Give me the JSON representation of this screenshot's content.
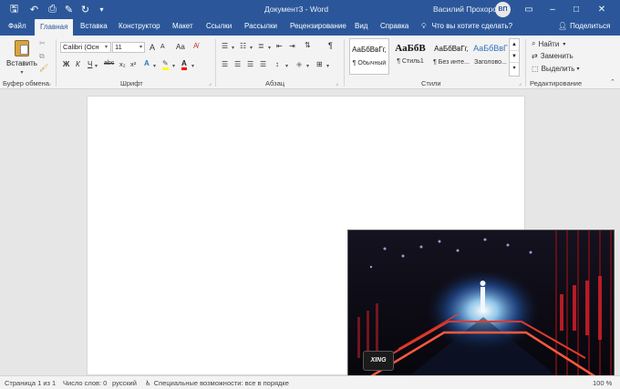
{
  "titlebar": {
    "document_title": "Документ3 - Word",
    "user_name": "Василий Прохоров",
    "user_initials": "ВП"
  },
  "tabs": [
    "Файл",
    "Главная",
    "Вставка",
    "Конструктор",
    "Макет",
    "Ссылки",
    "Рассылки",
    "Рецензирование",
    "Вид",
    "Справка"
  ],
  "tell_me": "Что вы хотите сделать?",
  "share": "Поделиться",
  "clipboard": {
    "paste": "Вставить",
    "label": "Буфер обмена"
  },
  "font": {
    "name": "Calibri (Осн",
    "size": "11",
    "label": "Шрифт",
    "bold": "Ж",
    "italic": "К",
    "underline": "Ч",
    "strike": "abc",
    "sub": "x₂",
    "sup": "x²",
    "grow": "A",
    "shrink": "A",
    "case": "Аа"
  },
  "paragraph": {
    "label": "Абзац"
  },
  "styles": {
    "label": "Стили",
    "items": [
      {
        "sample": "АаБбВвГг,",
        "name": "¶ Обычный"
      },
      {
        "sample": "АаБбВ",
        "name": "¶ Стиль1"
      },
      {
        "sample": "АаБбВвГг,",
        "name": "¶ Без инте..."
      },
      {
        "sample": "АаБбВвГ",
        "name": "Заголово..."
      }
    ]
  },
  "editing": {
    "find": "Найти",
    "replace": "Заменить",
    "select": "Выделить",
    "label": "Редактирование"
  },
  "status": {
    "page": "Страница 1 из 1",
    "words": "Число слов: 0",
    "language": "русский",
    "accessibility": "Специальные возможности: все в порядке",
    "zoom": "100 %"
  },
  "video": {
    "logo_text": "XING"
  },
  "colors": {
    "accent": "#2b579a",
    "highlight": "#ffff00",
    "font_color": "#ff0000"
  }
}
